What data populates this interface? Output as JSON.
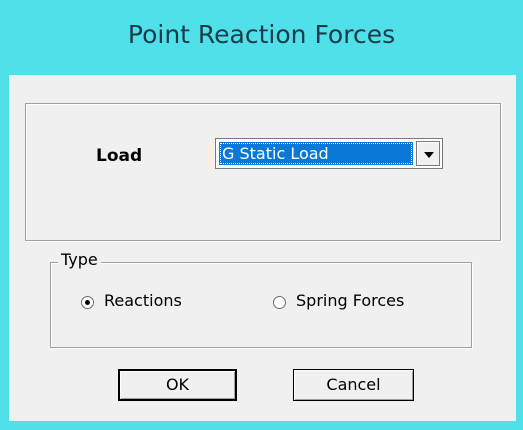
{
  "window": {
    "title": "Point Reaction Forces",
    "title_bar_color": "#4fe0ea"
  },
  "load": {
    "label": "Load",
    "selected_value": "G Static Load",
    "highlight_color": "#0a78d7"
  },
  "type": {
    "legend": "Type",
    "options": [
      {
        "label": "Reactions",
        "checked": true
      },
      {
        "label": "Spring Forces",
        "checked": false
      }
    ]
  },
  "buttons": {
    "ok_label": "OK",
    "cancel_label": "Cancel"
  }
}
